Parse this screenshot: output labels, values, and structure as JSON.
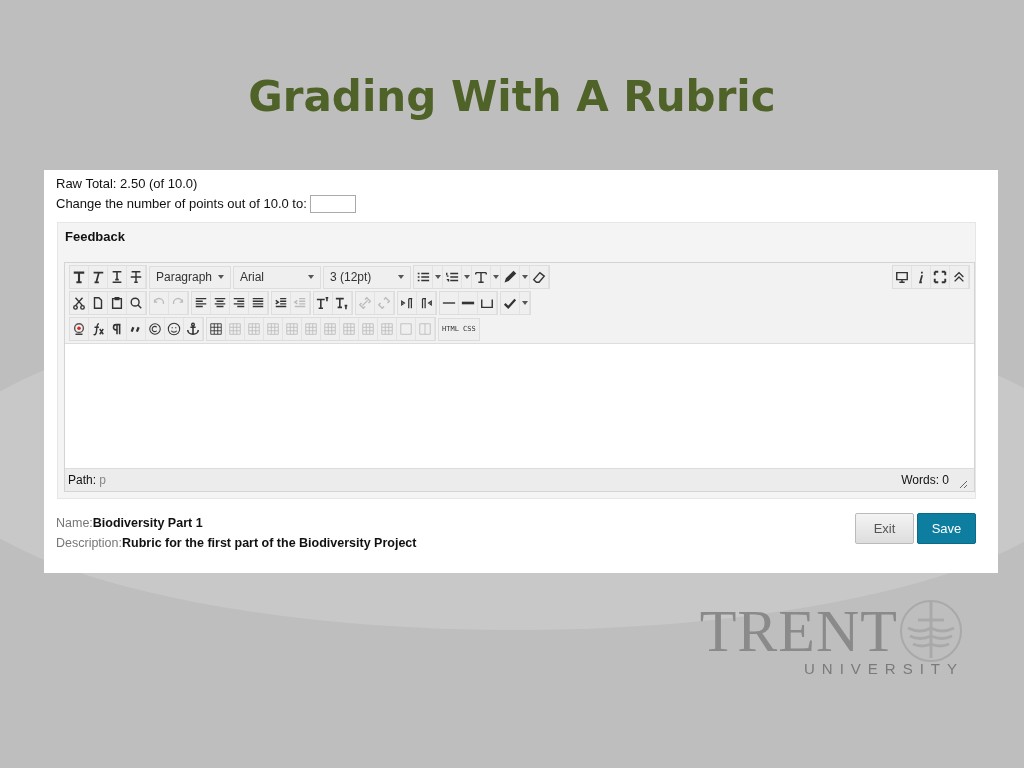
{
  "slide_title": "Grading With A Rubric",
  "raw_total": "Raw Total: 2.50 (of 10.0)",
  "points_label": "Change the number of points out of 10.0 to:",
  "feedback": {
    "heading": "Feedback",
    "dropdowns": [
      {
        "value": "Paragraph",
        "kind": "narrow"
      },
      {
        "value": "Arial",
        "kind": "wide"
      },
      {
        "value": "3 (12pt)",
        "kind": "wide"
      }
    ],
    "source_button": "HTML CSS",
    "path_label": "Path:",
    "path_value": "p",
    "word_count": "Words: 0"
  },
  "name_label": "Name:",
  "name_value": "Biodiversity Part 1",
  "description_label": "Description:",
  "description_value": "Rubric for the first part of the Biodiversity Project",
  "buttons": [
    {
      "label": "Exit",
      "kind": "secondary"
    },
    {
      "label": "Save",
      "kind": "primary"
    }
  ],
  "logo": {
    "wordmark": "TRENT",
    "subtitle": "UNIVERSITY"
  }
}
